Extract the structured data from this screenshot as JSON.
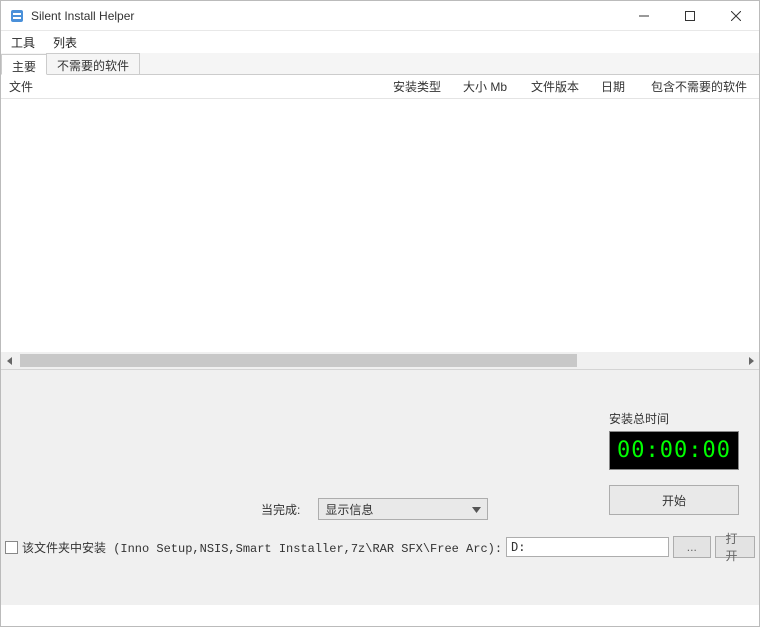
{
  "window": {
    "title": "Silent Install Helper"
  },
  "menu": {
    "tools": "工具",
    "list": "列表"
  },
  "tabs": {
    "main": "主要",
    "unwanted": "不需要的软件"
  },
  "columns": {
    "file": "文件",
    "install_type": "安装类型",
    "size_mb": "大小 Mb",
    "file_version": "文件版本",
    "date": "日期",
    "contains_unwanted": "包含不需要的软件"
  },
  "timer": {
    "label": "安装总时间",
    "value": "00:00:00"
  },
  "buttons": {
    "start": "开始",
    "browse": "...",
    "open": "打开"
  },
  "when_done": {
    "label": "当完成:",
    "selected": "显示信息"
  },
  "folder": {
    "checkbox_label": "该文件夹中安装 (Inno Setup,NSIS,Smart Installer,7z\\RAR SFX\\Free Arc):",
    "path": "D:"
  }
}
